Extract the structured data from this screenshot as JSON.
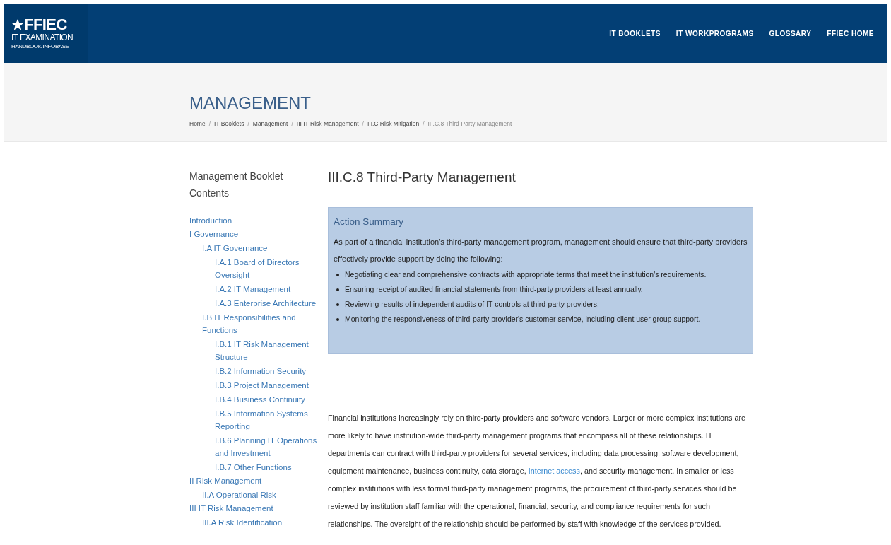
{
  "header": {
    "logo": {
      "mark": "FFIEC",
      "line1": "IT EXAMINATION",
      "line2": "HANDBOOK INFOBASE"
    },
    "nav": [
      "IT BOOKLETS",
      "IT WORKPROGRAMS",
      "GLOSSARY",
      "FFIEC HOME"
    ]
  },
  "hero": {
    "title": "MANAGEMENT",
    "separator": "/",
    "breadcrumb": [
      {
        "label": "Home",
        "current": false
      },
      {
        "label": "IT Booklets",
        "current": false
      },
      {
        "label": "Management",
        "current": false
      },
      {
        "label": "III IT Risk Management",
        "current": false
      },
      {
        "label": "III.C Risk Mitigation",
        "current": false
      },
      {
        "label": "III.C.8 Third-Party Management",
        "current": true
      }
    ]
  },
  "sidebar": {
    "title": "Management Booklet Contents",
    "items": [
      {
        "label": "Introduction"
      },
      {
        "label": "I Governance",
        "children": [
          {
            "label": "I.A IT Governance",
            "children": [
              {
                "label": "I.A.1 Board of Directors Oversight"
              },
              {
                "label": "I.A.2 IT Management"
              },
              {
                "label": "I.A.3 Enterprise Architecture"
              }
            ]
          },
          {
            "label": "I.B IT Responsibilities and Functions",
            "children": [
              {
                "label": "I.B.1 IT Risk Management Structure"
              },
              {
                "label": "I.B.2 Information Security"
              },
              {
                "label": "I.B.3 Project Management"
              },
              {
                "label": "I.B.4 Business Continuity"
              },
              {
                "label": "I.B.5 Information Systems Reporting"
              },
              {
                "label": "I.B.6 Planning IT Operations and Investment"
              },
              {
                "label": "I.B.7 Other Functions"
              }
            ]
          }
        ]
      },
      {
        "label": "II Risk Management",
        "children": [
          {
            "label": "II.A Operational Risk"
          }
        ]
      },
      {
        "label": "III IT Risk Management",
        "children": [
          {
            "label": "III.A Risk Identification"
          }
        ]
      }
    ]
  },
  "article": {
    "title": "III.C.8 Third-Party Management",
    "summary": {
      "title": "Action Summary",
      "intro": "As part of a financial institution's third-party management program, management should ensure that third-party providers effectively provide support by doing the following:",
      "bullets": [
        "Negotiating clear and comprehensive contracts with appropriate terms that meet the institution's requirements.",
        "Ensuring receipt of audited financial statements from third-party providers at least annually.",
        "Reviewing results of independent audits of IT controls at third-party providers.",
        "Monitoring the responsiveness of third-party provider's customer service, including client user group support."
      ]
    },
    "paragraph": [
      {
        "kind": "text",
        "text": "Financial institutions increasingly rely on third-party providers and software vendors. Larger or more complex institutions are more likely to have institution-wide third-party management programs that encompass all of these relationships. IT departments can contract with third-party providers for several services, including data processing, software development, equipment maintenance, business continuity, data storage, "
      },
      {
        "kind": "link",
        "text": "Internet access"
      },
      {
        "kind": "text",
        "text": ", and security management. In smaller or less complex institutions with less formal third-party management programs, the procurement of third-party services should be reviewed by institution staff familiar with the operational, financial, security, and compliance requirements for such relationships. The oversight of the relationship should be performed by staff with knowledge of the services provided."
      }
    ]
  }
}
